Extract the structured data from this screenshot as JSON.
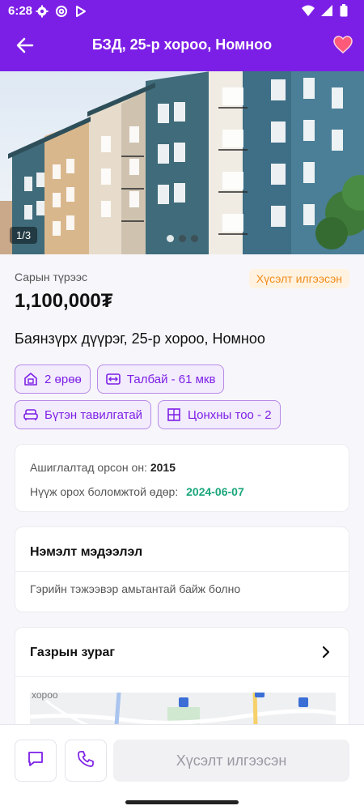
{
  "status_bar": {
    "time": "6:28",
    "left_icons": [
      "gear-icon",
      "at-sign-icon",
      "play-store-icon"
    ],
    "right_icons": [
      "wifi-icon",
      "signal-icon",
      "battery-icon"
    ]
  },
  "app_bar": {
    "title": "БЗД, 25-р хороо, Номноо",
    "back_icon": "arrow-left-icon",
    "favorite_icon": "heart-icon",
    "color": "#7c1fe6"
  },
  "gallery": {
    "counter": "1/3",
    "dots_total": 3,
    "active_dot": 1
  },
  "listing": {
    "price_label": "Сарын түрээс",
    "status": "Хүсэлт илгээсэн",
    "price": "1,100,000₮",
    "address": "Баянзүрх дүүрэг, 25-р хороо, Номноо"
  },
  "features": [
    {
      "icon": "door-icon",
      "label": "2 өрөө"
    },
    {
      "icon": "area-icon",
      "label": "Талбай - 61 мкв"
    },
    {
      "icon": "sofa-icon",
      "label": "Бүтэн тавилгатай"
    },
    {
      "icon": "window-icon",
      "label": "Цонхны тоо - 2"
    }
  ],
  "info": {
    "year_label": "Ашиглалтад орсон он:",
    "year_value": "2015",
    "move_label": "Нүүж орох боломжтой өдөр:",
    "move_value": "2024-06-07"
  },
  "extra": {
    "title": "Нэмэлт мэдээлэл",
    "text": "Гэрийн тэжээвэр амьтантай байж болно"
  },
  "map": {
    "title": "Газрын зураг",
    "thumb_text": "хороо"
  },
  "bottom": {
    "message_icon": "message-icon",
    "phone_icon": "phone-icon",
    "main_button": "Хүсэлт илгээсэн"
  },
  "colors": {
    "primary": "#7c1fe6",
    "status_orange": "#f08c1c",
    "date_green": "#1aa67a"
  }
}
